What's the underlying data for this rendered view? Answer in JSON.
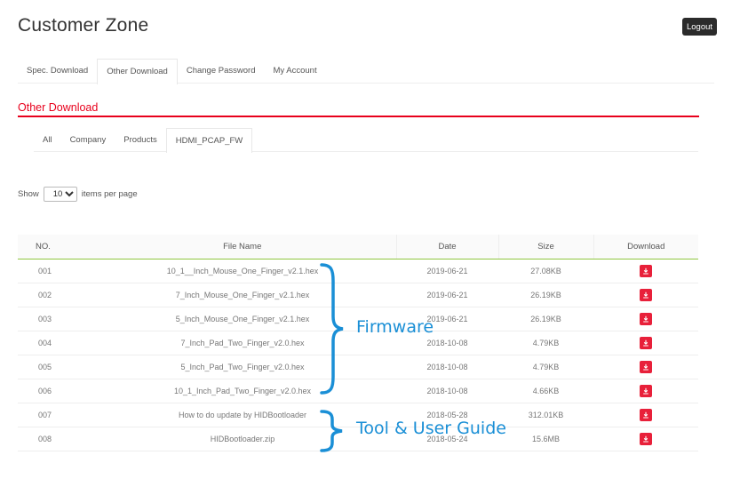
{
  "header": {
    "title": "Customer Zone",
    "logout_label": "Logout"
  },
  "nav": {
    "tabs": [
      {
        "label": "Spec. Download"
      },
      {
        "label": "Other Download"
      },
      {
        "label": "Change Password"
      },
      {
        "label": "My Account"
      }
    ]
  },
  "section": {
    "title": "Other Download"
  },
  "filters": {
    "tabs": [
      {
        "label": "All"
      },
      {
        "label": "Company"
      },
      {
        "label": "Products"
      },
      {
        "label": "HDMI_PCAP_FW"
      }
    ]
  },
  "pagination": {
    "show_label": "Show",
    "per_page_value": "10",
    "suffix": "items per page"
  },
  "table": {
    "headers": {
      "no": "NO.",
      "file_name": "File Name",
      "date": "Date",
      "size": "Size",
      "download": "Download"
    },
    "rows": [
      {
        "no": "001",
        "file_name": "10_1__Inch_Mouse_One_Finger_v2.1.hex",
        "date": "2019-06-21",
        "size": "27.08KB"
      },
      {
        "no": "002",
        "file_name": "7_Inch_Mouse_One_Finger_v2.1.hex",
        "date": "2019-06-21",
        "size": "26.19KB"
      },
      {
        "no": "003",
        "file_name": "5_Inch_Mouse_One_Finger_v2.1.hex",
        "date": "2019-06-21",
        "size": "26.19KB"
      },
      {
        "no": "004",
        "file_name": "7_Inch_Pad_Two_Finger_v2.0.hex",
        "date": "2018-10-08",
        "size": "4.79KB"
      },
      {
        "no": "005",
        "file_name": "5_Inch_Pad_Two_Finger_v2.0.hex",
        "date": "2018-10-08",
        "size": "4.79KB"
      },
      {
        "no": "006",
        "file_name": "10_1_Inch_Pad_Two_Finger_v2.0.hex",
        "date": "2018-10-08",
        "size": "4.66KB"
      },
      {
        "no": "007",
        "file_name": "How to do update by HIDBootloader",
        "date": "2018-05-28",
        "size": "312.01KB"
      },
      {
        "no": "008",
        "file_name": "HIDBootloader.zip",
        "date": "2018-05-24",
        "size": "15.6MB"
      }
    ]
  },
  "annotations": {
    "firmware": "Firmware",
    "tool": "Tool & User Guide"
  },
  "colors": {
    "accent_red": "#e8001c",
    "download_red": "#e8203a",
    "header_rule_green": "#8fc63f",
    "annotation_blue": "#1a8fd6"
  },
  "icons": {
    "download": "download-icon",
    "select_caret": "chevron-down-icon"
  }
}
